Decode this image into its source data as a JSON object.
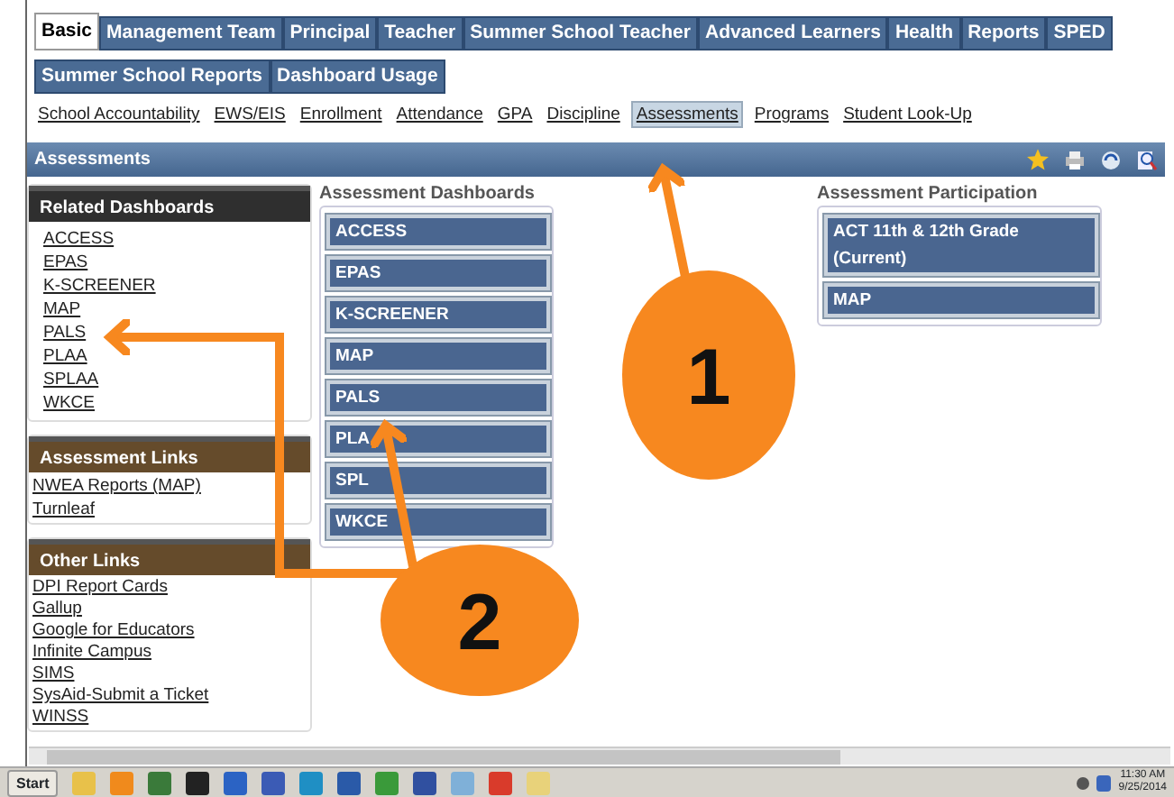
{
  "tabs": [
    {
      "label": "Basic",
      "selected": true
    },
    {
      "label": "Management Team",
      "selected": false
    },
    {
      "label": "Principal",
      "selected": false
    },
    {
      "label": "Teacher",
      "selected": false
    },
    {
      "label": "Summer School Teacher",
      "selected": false
    },
    {
      "label": "Advanced Learners",
      "selected": false
    },
    {
      "label": "Health",
      "selected": false
    },
    {
      "label": "Reports",
      "selected": false
    },
    {
      "label": "SPED",
      "selected": false
    },
    {
      "label": "Summer School Reports",
      "selected": false
    },
    {
      "label": "Dashboard Usage",
      "selected": false
    }
  ],
  "sub_links": [
    {
      "label": "School Accountability",
      "selected": false
    },
    {
      "label": "EWS/EIS",
      "selected": false
    },
    {
      "label": "Enrollment",
      "selected": false
    },
    {
      "label": "Attendance",
      "selected": false
    },
    {
      "label": "GPA",
      "selected": false
    },
    {
      "label": "Discipline",
      "selected": false
    },
    {
      "label": "Assessments",
      "selected": true
    },
    {
      "label": "Programs",
      "selected": false
    },
    {
      "label": "Student Look-Up",
      "selected": false
    }
  ],
  "page_title": "Assessments",
  "sidebar": [
    {
      "title": "Related Dashboards",
      "color": "#2f2f2f",
      "links": [
        "ACCESS",
        "EPAS",
        "K-SCREENER",
        "MAP",
        "PALS",
        "PLAA",
        "SPLAA",
        "WKCE"
      ]
    },
    {
      "title": "Assessment Links",
      "color": "#654b2b",
      "links": [
        "NWEA Reports (MAP)",
        "Turnleaf"
      ]
    },
    {
      "title": "Other Links",
      "color": "#654b2b",
      "links": [
        "DPI Report Cards",
        "Gallup",
        "Google for Educators",
        "Infinite Campus",
        "SIMS",
        "SysAid-Submit a Ticket",
        "WINSS"
      ]
    }
  ],
  "dashboards": {
    "title": "Assessment Dashboards",
    "buttons": [
      "ACCESS",
      "EPAS",
      "K-SCREENER",
      "MAP",
      "PALS",
      "PLA",
      "SPL",
      "WKCE"
    ]
  },
  "participation": {
    "title": "Assessment Participation",
    "buttons": [
      "ACT 11th & 12th Grade (Current)",
      "MAP"
    ]
  },
  "taskbar": {
    "start": "Start",
    "icons": [
      {
        "color": "#e8c14a"
      },
      {
        "color": "#f08a1c"
      },
      {
        "color": "#3a7a3a"
      },
      {
        "color": "#222222"
      },
      {
        "color": "#2b63c4"
      },
      {
        "color": "#3b5bb5"
      },
      {
        "color": "#1f8fc4"
      },
      {
        "color": "#2a5aa8"
      },
      {
        "color": "#3a9a3a"
      },
      {
        "color": "#3050a0"
      },
      {
        "color": "#7fb0d8"
      },
      {
        "color": "#d93b2b"
      },
      {
        "color": "#e8d27a"
      }
    ],
    "time": "11:30 AM",
    "date": "9/25/2014"
  },
  "annotations": [
    {
      "label": "1"
    },
    {
      "label": "2"
    }
  ]
}
